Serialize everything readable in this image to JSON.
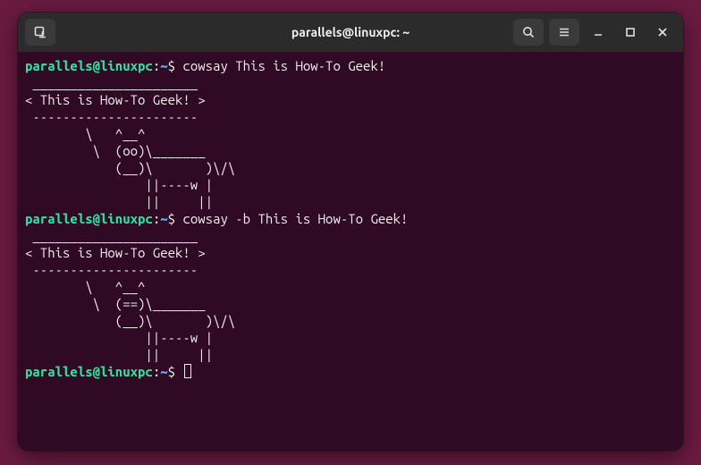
{
  "window": {
    "title": "parallels@linuxpc: ~"
  },
  "prompt": {
    "userhost": "parallels@linuxpc",
    "sep": ":",
    "path": "~",
    "symbol": "$"
  },
  "session": [
    {
      "command": "cowsay This is How-To Geek!",
      "output": [
        " ______________________",
        "< This is How-To Geek! >",
        " ----------------------",
        "        \\   ^__^",
        "         \\  (oo)\\_______",
        "            (__)\\       )\\/\\",
        "                ||----w |",
        "                ||     ||"
      ]
    },
    {
      "command": "cowsay -b This is How-To Geek!",
      "output": [
        " ______________________",
        "< This is How-To Geek! >",
        " ----------------------",
        "        \\   ^__^",
        "         \\  (==)\\_______",
        "            (__)\\       )\\/\\",
        "                ||----w |",
        "                ||     ||"
      ]
    }
  ],
  "icons": {
    "new_tab": "new-tab",
    "search": "search",
    "menu": "menu",
    "minimize": "minimize",
    "maximize": "maximize",
    "close": "close"
  }
}
